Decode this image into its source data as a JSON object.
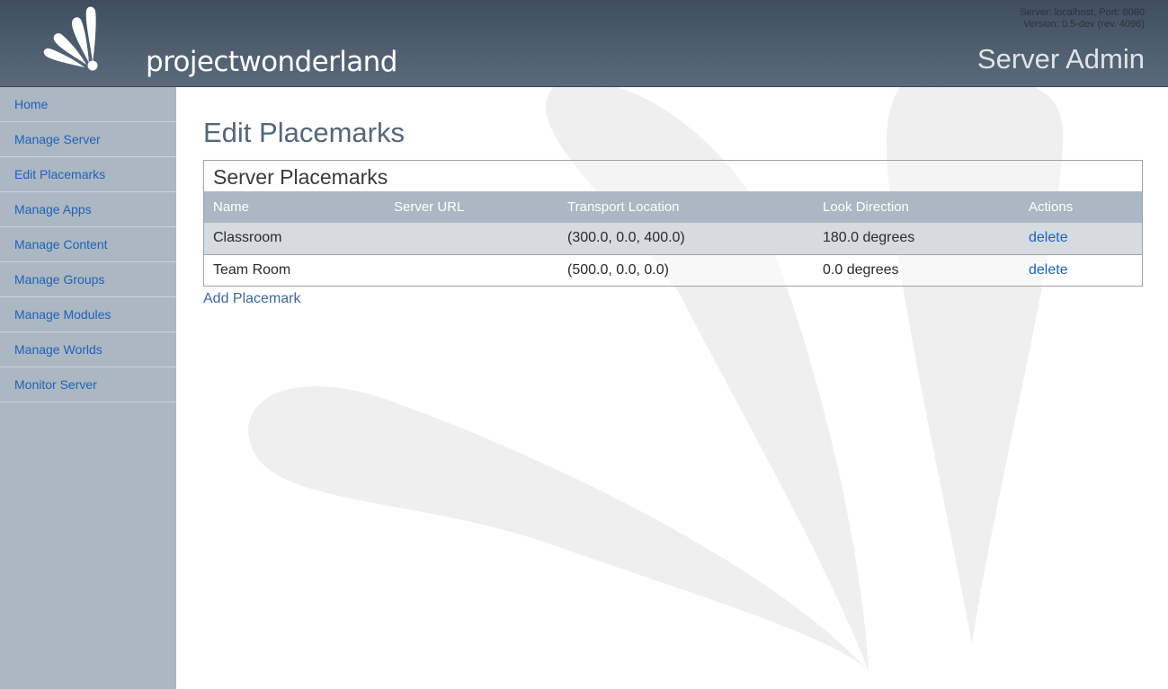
{
  "header": {
    "logo_text": "projectwonderland",
    "server_line": "Server: localhost, Port: 8080",
    "version_line": "Version: 0.5-dev (rev. 4096)",
    "section_title": "Server Admin"
  },
  "sidebar": {
    "items": [
      {
        "label": "Home"
      },
      {
        "label": "Manage Server"
      },
      {
        "label": "Edit Placemarks"
      },
      {
        "label": "Manage Apps"
      },
      {
        "label": "Manage Content"
      },
      {
        "label": "Manage Groups"
      },
      {
        "label": "Manage Modules"
      },
      {
        "label": "Manage Worlds"
      },
      {
        "label": "Monitor Server"
      }
    ]
  },
  "main": {
    "title": "Edit Placemarks",
    "box_title": "Server Placemarks",
    "columns": [
      "Name",
      "Server URL",
      "Transport Location",
      "Look Direction",
      "Actions"
    ],
    "rows": [
      {
        "name": "Classroom",
        "server_url": "",
        "location": "(300.0, 0.0, 400.0)",
        "direction": "180.0 degrees",
        "action": "delete"
      },
      {
        "name": "Team Room",
        "server_url": "",
        "location": "(500.0, 0.0, 0.0)",
        "direction": "0.0 degrees",
        "action": "delete"
      }
    ],
    "add_link": "Add Placemark"
  },
  "colors": {
    "header_bg": "#4d5d6d",
    "sidebar_bg": "#abb7c2",
    "link": "#1f62b8",
    "title": "#56667a"
  }
}
